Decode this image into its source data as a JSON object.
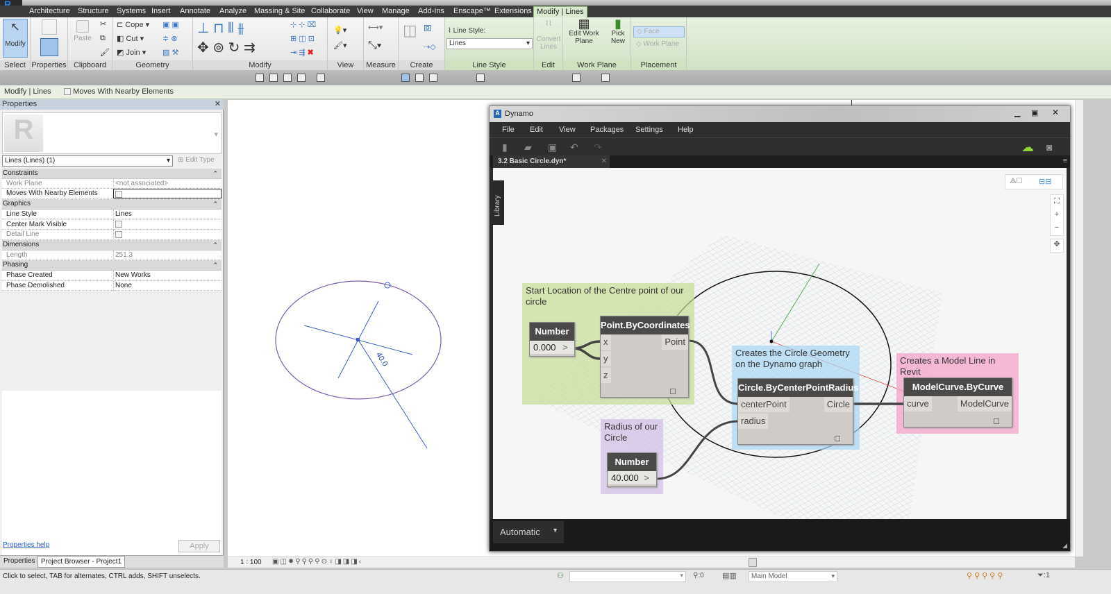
{
  "ribbon": {
    "tabs": [
      "Architecture",
      "Structure",
      "Systems",
      "Insert",
      "Annotate",
      "Analyze",
      "Massing & Site",
      "Collaborate",
      "View",
      "Manage",
      "Add-Ins",
      "Enscape™",
      "Extensions",
      "Modify | Lines"
    ],
    "panels": {
      "select": "Select",
      "properties": "Properties",
      "clipboard": "Clipboard",
      "geometry": "Geometry",
      "modify": "Modify",
      "view": "View",
      "measure": "Measure",
      "create": "Create",
      "line_style": "Line Style",
      "edit": "Edit",
      "work_plane": "Work Plane",
      "placement": "Placement"
    },
    "buttons": {
      "modify": "Modify",
      "paste": "Paste",
      "cope": "Cope",
      "cut": "Cut",
      "join": "Join",
      "line_style_label": "Line Style:",
      "line_style_value": "Lines",
      "convert_lines": "Convert Lines",
      "edit_work_plane": "Edit Work Plane",
      "pick_new": "Pick New",
      "face": "Face",
      "work_plane": "Work Plane"
    }
  },
  "options_bar": {
    "context": "Modify | Lines",
    "moves_with": "Moves With Nearby Elements"
  },
  "properties": {
    "title": "Properties",
    "type_selector": "Lines (Lines) (1)",
    "edit_type": "Edit Type",
    "rows": [
      {
        "group": "Constraints"
      },
      {
        "k": "Work Plane",
        "v": "<not associated>",
        "dis": true
      },
      {
        "k": "Moves With Nearby Elements",
        "chk": true
      },
      {
        "group": "Graphics"
      },
      {
        "k": "Line Style",
        "v": "Lines"
      },
      {
        "k": "Center Mark Visible",
        "chk": true
      },
      {
        "k": "Detail Line",
        "chk": true,
        "dis": true
      },
      {
        "group": "Dimensions"
      },
      {
        "k": "Length",
        "v": "251.3",
        "dis": true
      },
      {
        "group": "Phasing"
      },
      {
        "k": "Phase Created",
        "v": "New Works"
      },
      {
        "k": "Phase Demolished",
        "v": "None"
      }
    ],
    "help": "Properties help",
    "apply": "Apply",
    "tabs": [
      "Properties",
      "Project Browser - Project1"
    ]
  },
  "drawing": {
    "dimension": "40.0",
    "scale": "1 : 100"
  },
  "dynamo": {
    "title": "Dynamo",
    "menu": [
      "File",
      "Edit",
      "View",
      "Packages",
      "Settings",
      "Help"
    ],
    "tab": "3.2 Basic Circle.dyn*",
    "library": "Library",
    "run_mode": "Automatic",
    "groups": {
      "g1": "Start Location of the Centre point of our circle",
      "g2": "Creates the Circle Geometry on the Dynamo graph",
      "g3": "Creates a Model Line in Revit",
      "g4": "Radius of our Circle"
    },
    "nodes": {
      "number1": {
        "title": "Number",
        "value": "0.000"
      },
      "point": {
        "title": "Point.ByCoordinates",
        "inputs": [
          "x",
          "y",
          "z"
        ],
        "output": "Point"
      },
      "circle": {
        "title": "Circle.ByCenterPointRadius",
        "inputs": [
          "centerPoint",
          "radius"
        ],
        "output": "Circle"
      },
      "model": {
        "title": "ModelCurve.ByCurve",
        "inputs": [
          "curve"
        ],
        "output": "ModelCurve"
      },
      "number2": {
        "title": "Number",
        "value": "40.000"
      }
    }
  },
  "status": {
    "text": "Click to select, TAB for alternates, CTRL adds, SHIFT unselects.",
    "counter": ":0",
    "model": "Main Model",
    "filter": ":1"
  }
}
